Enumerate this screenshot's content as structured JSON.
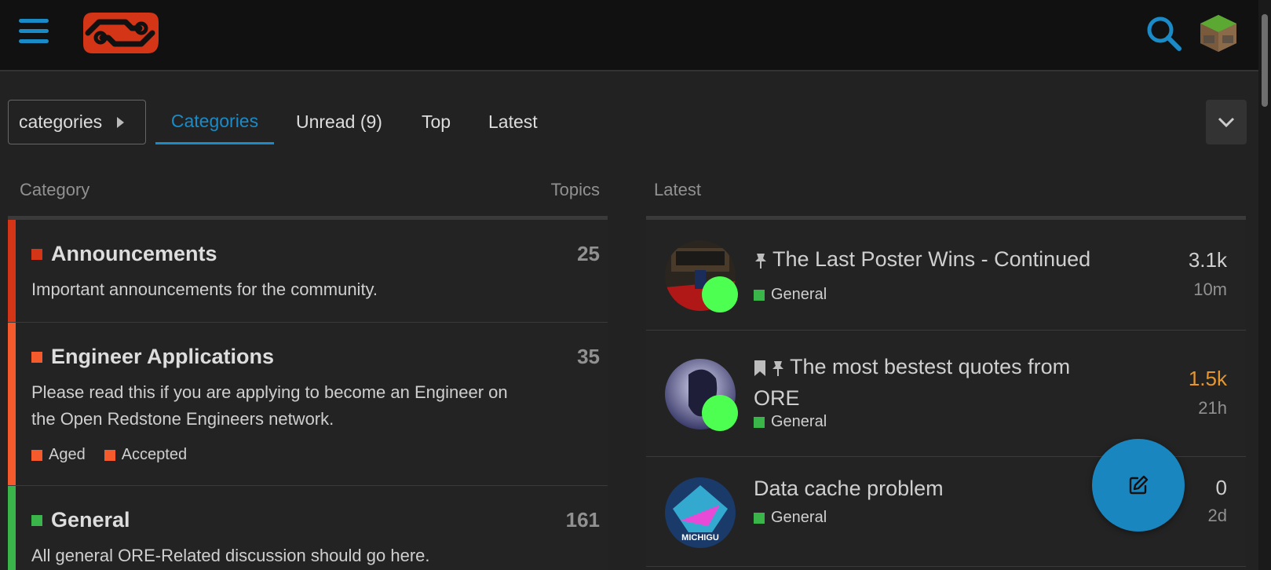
{
  "nav": {
    "breadcrumb_label": "categories",
    "tabs": [
      {
        "label": "Categories"
      },
      {
        "label": "Unread (9)"
      },
      {
        "label": "Top"
      },
      {
        "label": "Latest"
      }
    ]
  },
  "categories": {
    "header_category": "Category",
    "header_topics": "Topics",
    "items": [
      {
        "name": "Announcements",
        "count": "25",
        "description": "Important announcements for the community.",
        "color": "#d33516"
      },
      {
        "name": "Engineer Applications",
        "count": "35",
        "description": "Please read this if you are applying to become an Engineer on the Open Redstone Engineers network.",
        "color": "#f55a2c",
        "subcategories": [
          {
            "name": "Aged",
            "color": "#f55a2c"
          },
          {
            "name": "Accepted",
            "color": "#f55a2c"
          }
        ]
      },
      {
        "name": "General",
        "count": "161",
        "description": "All general ORE-Related discussion should go here.",
        "color": "#3ab54a"
      }
    ]
  },
  "latest": {
    "header": "Latest",
    "topics": [
      {
        "title": "The Last Poster Wins - Continued",
        "category": "General",
        "posts": "3.1k",
        "age": "10m",
        "pinned": true,
        "bookmarked": false
      },
      {
        "title": "The most bestest quotes from ORE",
        "category": "General",
        "posts": "1.5k",
        "age": "21h",
        "pinned": true,
        "bookmarked": true,
        "posts_color": "#e6962b"
      },
      {
        "title": "Data cache problem",
        "category": "General",
        "posts": "0",
        "age": "2d",
        "pinned": false,
        "bookmarked": false
      },
      {
        "avatar_text": "MICHIGU"
      }
    ]
  },
  "colors": {
    "accent": "#1a8bc7",
    "logo": "#d33516",
    "online": "#4cff50",
    "hot_posts": "#e6962b"
  },
  "icons": {
    "menu": "hamburger-icon",
    "search": "search-icon",
    "dropdown": "chevron-down-icon",
    "new_topic": "pencil-square-icon",
    "pin": "pin-icon",
    "bookmark": "bookmark-icon"
  }
}
